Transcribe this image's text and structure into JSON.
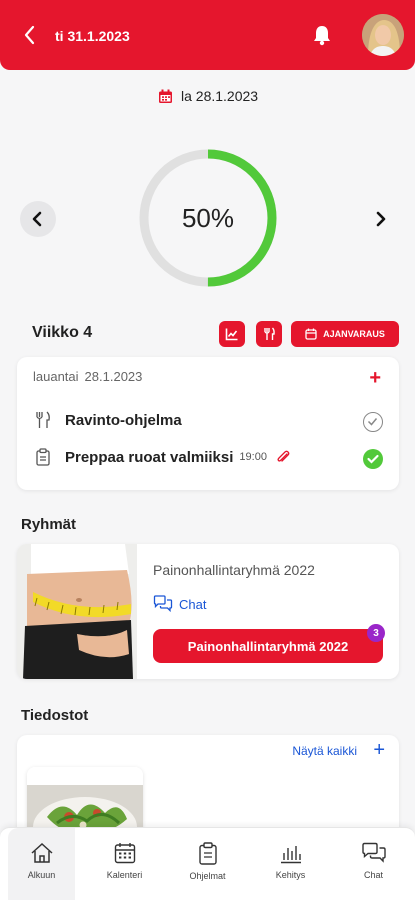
{
  "header": {
    "back_icon": "chevron-left-icon",
    "date": "ti 31.1.2023",
    "bell_icon": "bell-icon",
    "avatar": "user-avatar"
  },
  "selected_date": {
    "icon": "calendar-icon",
    "label": "la 28.1.2023"
  },
  "progress": {
    "value": 50,
    "label": "50%",
    "color": "#52c93a",
    "track_color": "#e0e0e0"
  },
  "week": {
    "title": "Viikko 4",
    "buttons": [
      {
        "icon": "chart-icon"
      },
      {
        "icon": "cutlery-icon"
      },
      {
        "icon": "calendar-icon",
        "label": "AJANVARAUS"
      }
    ]
  },
  "day": {
    "weekday": "lauantai",
    "date": "28.1.2023",
    "tasks": [
      {
        "icon": "cutlery-icon",
        "title": "Ravinto-ohjelma",
        "time": "",
        "done": false
      },
      {
        "icon": "clipboard-icon",
        "title": "Preppaa ruoat valmiiksi",
        "time": "19:00",
        "attachment_icon": "paperclip-icon",
        "done": true
      }
    ]
  },
  "groups": {
    "title": "Ryhmät",
    "items": [
      {
        "name": "Painonhallintaryhmä 2022",
        "chat_label": "Chat",
        "button_label": "Painonhallintaryhmä 2022",
        "badge": "3"
      }
    ]
  },
  "files": {
    "title": "Tiedostot",
    "show_all": "Näytä kaikki"
  },
  "tabbar": [
    {
      "label": "Alkuun",
      "icon": "home-icon",
      "active": true
    },
    {
      "label": "Kalenteri",
      "icon": "calendar-grid-icon",
      "active": false
    },
    {
      "label": "Ohjelmat",
      "icon": "clipboard-icon",
      "active": false
    },
    {
      "label": "Kehitys",
      "icon": "bar-chart-icon",
      "active": false
    },
    {
      "label": "Chat",
      "icon": "chat-bubbles-icon",
      "active": false
    }
  ],
  "colors": {
    "brand_red": "#e5162d",
    "link_blue": "#1a56d6",
    "badge_purple": "#9a26c9",
    "success_green": "#52c93a"
  }
}
